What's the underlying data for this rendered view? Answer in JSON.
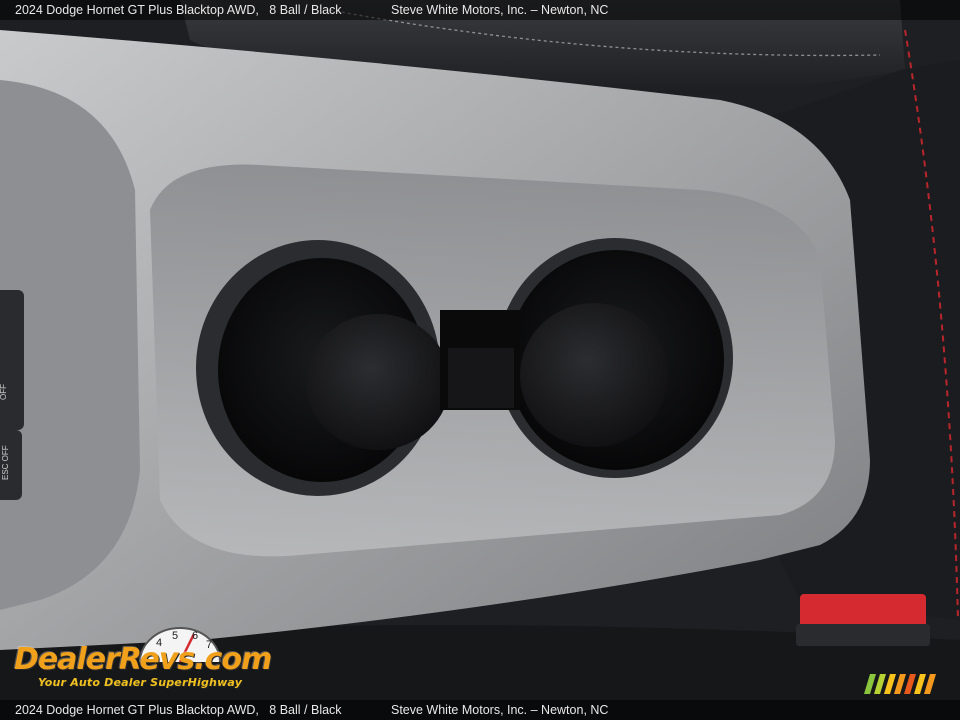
{
  "caption": {
    "vehicle": "2024 Dodge Hornet GT Plus Blacktop AWD,",
    "color": "8 Ball / Black",
    "dealer": "Steve White Motors, Inc. – Newton, NC"
  },
  "console_buttons": {
    "park_assist_label": "OFF",
    "esc_label": "ESC OFF"
  },
  "watermark": {
    "brand": "DealerRevs.com",
    "tagline": "Your Auto Dealer SuperHighway",
    "gauge_numbers": [
      "4",
      "5",
      "6",
      "7"
    ]
  },
  "colors": {
    "trim_silver": "#a8a9ab",
    "cupholder_black": "#0d0d0f",
    "accent_red": "#e0202a",
    "watermark_orange": "#f0a01a"
  }
}
